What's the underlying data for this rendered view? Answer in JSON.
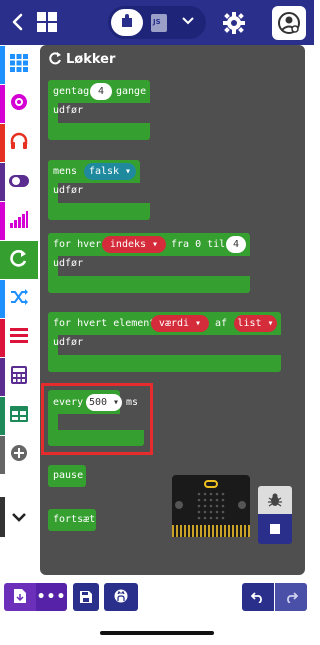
{
  "header": {
    "js_tab_label": "JS"
  },
  "flyout": {
    "title": "Løkker",
    "blocks": {
      "repeat": {
        "label": "gentag",
        "count": "4",
        "suffix": "gange",
        "do": "udfør"
      },
      "while": {
        "label": "mens",
        "condition": "falsk",
        "do": "udfør"
      },
      "for": {
        "label": "for hver",
        "var": "indeks",
        "from": "fra 0 til",
        "to": "4",
        "do": "udfør"
      },
      "foreach": {
        "label": "for hvert element",
        "var": "værdi",
        "of": "af",
        "list": "list",
        "do": "udfør"
      },
      "every": {
        "label": "every",
        "ms": "500",
        "unit": "ms"
      },
      "pause": {
        "label": "pause"
      },
      "continue": {
        "label": "fortsæt"
      }
    }
  },
  "colors": {
    "primary": "#2a2f8c",
    "loops": "#35a02f",
    "variable": "#d42c3a",
    "highlight": "#e52b2b"
  }
}
